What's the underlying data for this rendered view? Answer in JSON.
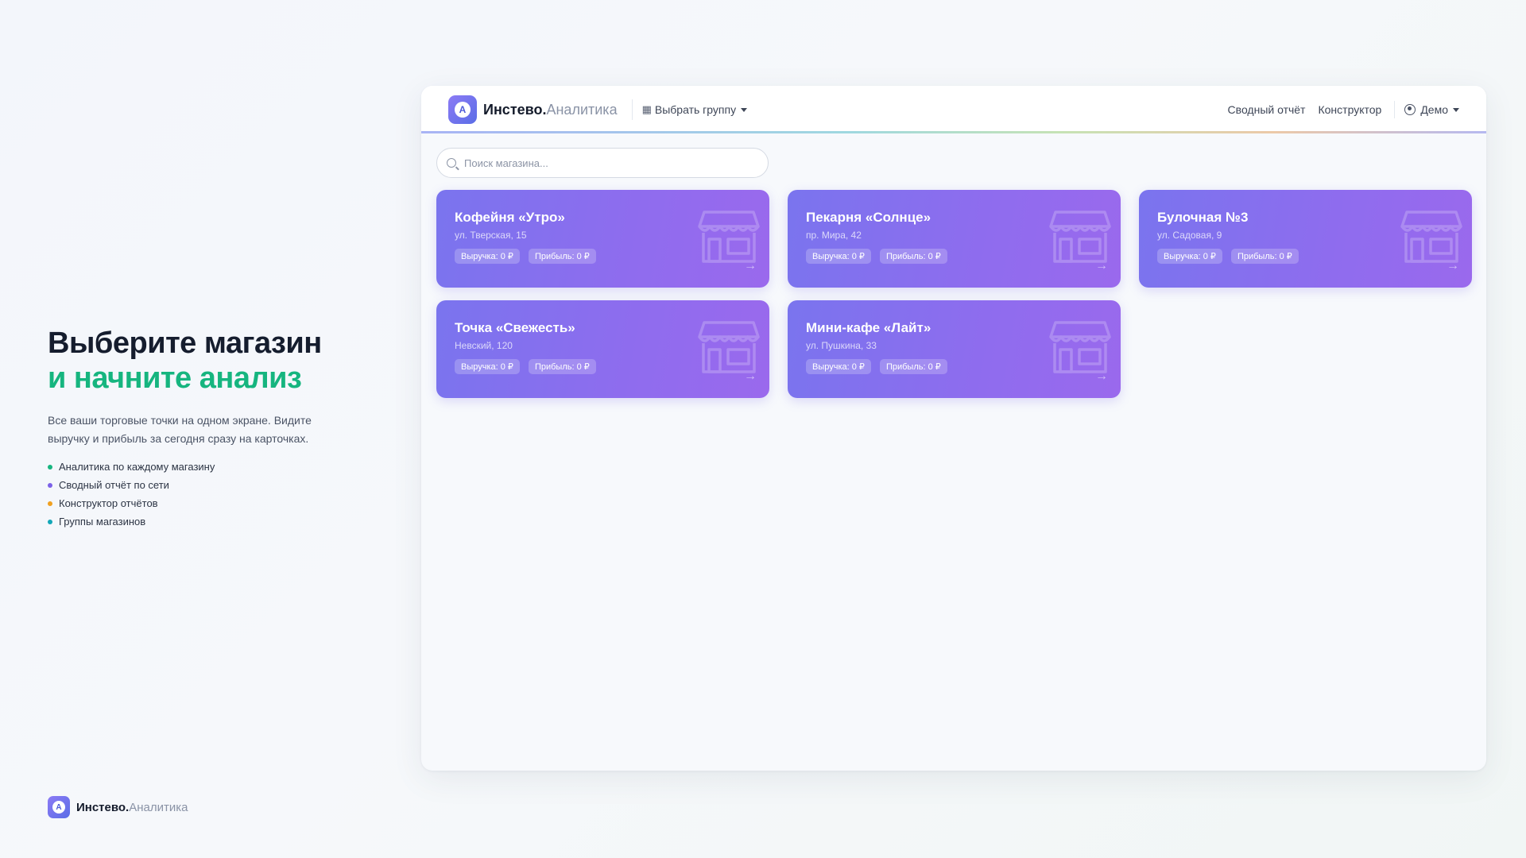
{
  "promo": {
    "title_line1": "Выберите магазин",
    "title_line2": "и начните анализ",
    "description": "Все ваши торговые точки на одном экране. Видите выручку и прибыль за сегодня сразу на карточках.",
    "features": [
      {
        "label": "Аналитика по каждому магазину",
        "color": "#16b57f"
      },
      {
        "label": "Сводный отчёт по сети",
        "color": "#7b61e8"
      },
      {
        "label": "Конструктор отчётов",
        "color": "#f0a020"
      },
      {
        "label": "Группы магазинов",
        "color": "#12a7b8"
      }
    ]
  },
  "brand": {
    "logo_letter": "A",
    "name_bold": "Инстево.",
    "name_light": "Аналитика"
  },
  "navbar": {
    "group_button": "Выбрать группу",
    "summary_link": "Сводный отчёт",
    "constructor_link": "Конструктор",
    "user_label": "Демо"
  },
  "search": {
    "placeholder": "Поиск магазина..."
  },
  "stores": [
    {
      "name": "Кофейня «Утро»",
      "address": "ул. Тверская, 15",
      "revenue": "Выручка: 0 ₽",
      "profit": "Прибыль: 0 ₽"
    },
    {
      "name": "Пекарня «Солнце»",
      "address": "пр. Мира, 42",
      "revenue": "Выручка: 0 ₽",
      "profit": "Прибыль: 0 ₽"
    },
    {
      "name": "Булочная №3",
      "address": "ул. Садовая, 9",
      "revenue": "Выручка: 0 ₽",
      "profit": "Прибыль: 0 ₽"
    },
    {
      "name": "Точка «Свежесть»",
      "address": "Невский, 120",
      "revenue": "Выручка: 0 ₽",
      "profit": "Прибыль: 0 ₽"
    },
    {
      "name": "Мини-кафе «Лайт»",
      "address": "ул. Пушкина, 33",
      "revenue": "Выручка: 0 ₽",
      "profit": "Прибыль: 0 ₽"
    }
  ]
}
